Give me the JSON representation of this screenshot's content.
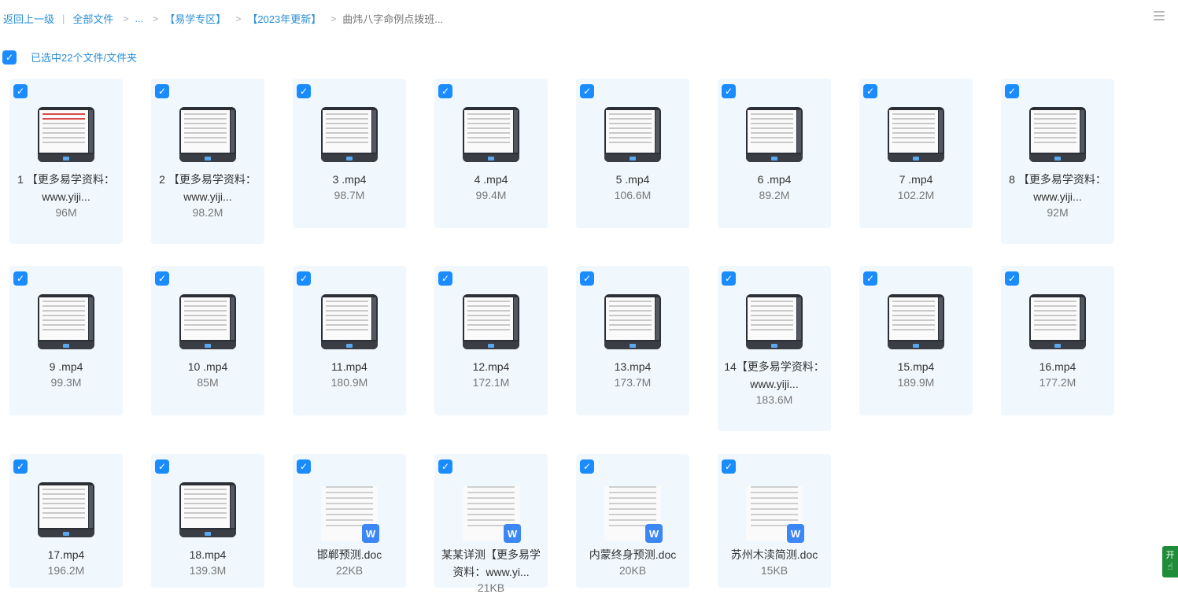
{
  "breadcrumb": {
    "back": "返回上一级",
    "all_files": "全部文件",
    "ellipsis": "...",
    "folder1": "【易学专区】",
    "folder2": "【2023年更新】",
    "current": "曲炜八字命例点拨班..."
  },
  "selection": {
    "label": "已选中22个文件/文件夹"
  },
  "files": [
    {
      "name": "1 【更多易学资料：www.yiji...",
      "size": "96M",
      "type": "video"
    },
    {
      "name": "2 【更多易学资料：www.yiji...",
      "size": "98.2M",
      "type": "video"
    },
    {
      "name": "3 .mp4",
      "size": "98.7M",
      "type": "video"
    },
    {
      "name": "4 .mp4",
      "size": "99.4M",
      "type": "video"
    },
    {
      "name": "5 .mp4",
      "size": "106.6M",
      "type": "video"
    },
    {
      "name": "6 .mp4",
      "size": "89.2M",
      "type": "video"
    },
    {
      "name": "7 .mp4",
      "size": "102.2M",
      "type": "video"
    },
    {
      "name": "8 【更多易学资料：www.yiji...",
      "size": "92M",
      "type": "video"
    },
    {
      "name": "9 .mp4",
      "size": "99.3M",
      "type": "video"
    },
    {
      "name": "10 .mp4",
      "size": "85M",
      "type": "video"
    },
    {
      "name": "11.mp4",
      "size": "180.9M",
      "type": "video"
    },
    {
      "name": "12.mp4",
      "size": "172.1M",
      "type": "video"
    },
    {
      "name": "13.mp4",
      "size": "173.7M",
      "type": "video"
    },
    {
      "name": "14【更多易学资料：www.yiji...",
      "size": "183.6M",
      "type": "video"
    },
    {
      "name": "15.mp4",
      "size": "189.9M",
      "type": "video"
    },
    {
      "name": "16.mp4",
      "size": "177.2M",
      "type": "video"
    },
    {
      "name": "17.mp4",
      "size": "196.2M",
      "type": "video"
    },
    {
      "name": "18.mp4",
      "size": "139.3M",
      "type": "video"
    },
    {
      "name": "邯郸预测.doc",
      "size": "22KB",
      "type": "doc"
    },
    {
      "name": "某某详测【更多易学资料：www.yi...",
      "size": "21KB",
      "type": "doc"
    },
    {
      "name": "内蒙终身预测.doc",
      "size": "20KB",
      "type": "doc"
    },
    {
      "name": "苏州木渎简测.doc",
      "size": "15KB",
      "type": "doc"
    }
  ],
  "icons": {
    "check": "✓",
    "doc_badge": "W"
  },
  "float_button": {
    "label": "开"
  },
  "colors": {
    "accent": "#1a8cff",
    "link": "#2a8fd6",
    "card_bg": "#f1f8fd",
    "word_blue": "#3c86f6"
  }
}
